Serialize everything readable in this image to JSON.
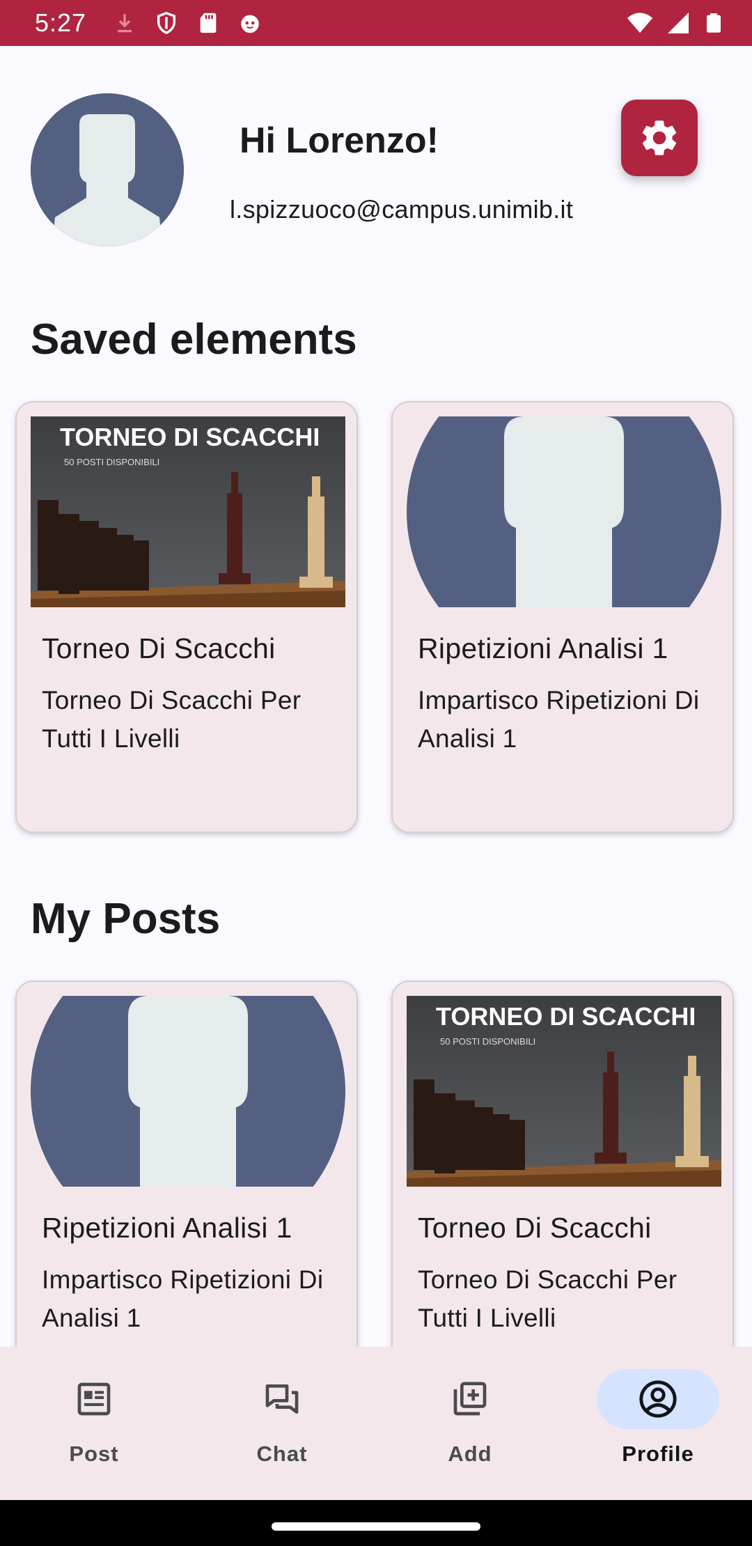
{
  "status_bar": {
    "time": "5:27",
    "icons_left": [
      "download-icon",
      "shield-icon",
      "sd-card-icon",
      "cat-icon"
    ],
    "icons_right": [
      "wifi-icon",
      "cell-signal-icon",
      "battery-icon"
    ],
    "background": "#b0243f"
  },
  "header": {
    "greeting": "Hi Lorenzo!",
    "email": "l.spizzuoco@campus.unimib.it",
    "settings_icon": "gear-icon"
  },
  "saved": {
    "title": "Saved elements",
    "items": [
      {
        "image": "chess-tournament",
        "image_heading": "TORNEO DI SCACCHI",
        "image_subheading": "50 POSTI DISPONIBILI",
        "title": "Torneo Di Scacchi",
        "description": "Torneo Di Scacchi Per Tutti I Livelli"
      },
      {
        "image": "default-avatar",
        "title": "Ripetizioni Analisi 1",
        "description": "Impartisco Ripetizioni Di Analisi 1"
      }
    ]
  },
  "my_posts": {
    "title": "My Posts",
    "items": [
      {
        "image": "default-avatar",
        "title": "Ripetizioni Analisi 1",
        "description": "Impartisco Ripetizioni Di Analisi 1"
      },
      {
        "image": "chess-tournament",
        "image_heading": "TORNEO DI SCACCHI",
        "image_subheading": "50 POSTI DISPONIBILI",
        "title": "Torneo Di Scacchi",
        "description": "Torneo Di Scacchi Per Tutti I Livelli"
      }
    ]
  },
  "bottom_nav": {
    "items": [
      {
        "label": "Post",
        "icon": "article-icon",
        "active": false
      },
      {
        "label": "Chat",
        "icon": "chat-icon",
        "active": false
      },
      {
        "label": "Add",
        "icon": "add-library-icon",
        "active": false
      },
      {
        "label": "Profile",
        "icon": "account-circle-icon",
        "active": true
      }
    ]
  },
  "colors": {
    "accent": "#b0243f",
    "card_background": "#f3e7ec",
    "avatar_background": "#546082",
    "avatar_silhouette": "#e6ebeb",
    "nav_active_pill": "#d6e3ff",
    "page_background": "#f9f9ff"
  }
}
